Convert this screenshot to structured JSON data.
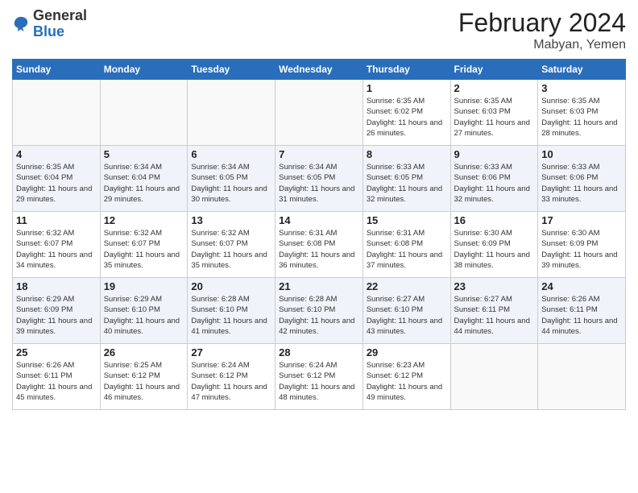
{
  "header": {
    "logo_general": "General",
    "logo_blue": "Blue",
    "month": "February 2024",
    "location": "Mabyan, Yemen"
  },
  "days_of_week": [
    "Sunday",
    "Monday",
    "Tuesday",
    "Wednesday",
    "Thursday",
    "Friday",
    "Saturday"
  ],
  "weeks": [
    [
      {
        "day": "",
        "info": ""
      },
      {
        "day": "",
        "info": ""
      },
      {
        "day": "",
        "info": ""
      },
      {
        "day": "",
        "info": ""
      },
      {
        "day": "1",
        "info": "Sunrise: 6:35 AM\nSunset: 6:02 PM\nDaylight: 11 hours and 26 minutes."
      },
      {
        "day": "2",
        "info": "Sunrise: 6:35 AM\nSunset: 6:03 PM\nDaylight: 11 hours and 27 minutes."
      },
      {
        "day": "3",
        "info": "Sunrise: 6:35 AM\nSunset: 6:03 PM\nDaylight: 11 hours and 28 minutes."
      }
    ],
    [
      {
        "day": "4",
        "info": "Sunrise: 6:35 AM\nSunset: 6:04 PM\nDaylight: 11 hours and 29 minutes."
      },
      {
        "day": "5",
        "info": "Sunrise: 6:34 AM\nSunset: 6:04 PM\nDaylight: 11 hours and 29 minutes."
      },
      {
        "day": "6",
        "info": "Sunrise: 6:34 AM\nSunset: 6:05 PM\nDaylight: 11 hours and 30 minutes."
      },
      {
        "day": "7",
        "info": "Sunrise: 6:34 AM\nSunset: 6:05 PM\nDaylight: 11 hours and 31 minutes."
      },
      {
        "day": "8",
        "info": "Sunrise: 6:33 AM\nSunset: 6:05 PM\nDaylight: 11 hours and 32 minutes."
      },
      {
        "day": "9",
        "info": "Sunrise: 6:33 AM\nSunset: 6:06 PM\nDaylight: 11 hours and 32 minutes."
      },
      {
        "day": "10",
        "info": "Sunrise: 6:33 AM\nSunset: 6:06 PM\nDaylight: 11 hours and 33 minutes."
      }
    ],
    [
      {
        "day": "11",
        "info": "Sunrise: 6:32 AM\nSunset: 6:07 PM\nDaylight: 11 hours and 34 minutes."
      },
      {
        "day": "12",
        "info": "Sunrise: 6:32 AM\nSunset: 6:07 PM\nDaylight: 11 hours and 35 minutes."
      },
      {
        "day": "13",
        "info": "Sunrise: 6:32 AM\nSunset: 6:07 PM\nDaylight: 11 hours and 35 minutes."
      },
      {
        "day": "14",
        "info": "Sunrise: 6:31 AM\nSunset: 6:08 PM\nDaylight: 11 hours and 36 minutes."
      },
      {
        "day": "15",
        "info": "Sunrise: 6:31 AM\nSunset: 6:08 PM\nDaylight: 11 hours and 37 minutes."
      },
      {
        "day": "16",
        "info": "Sunrise: 6:30 AM\nSunset: 6:09 PM\nDaylight: 11 hours and 38 minutes."
      },
      {
        "day": "17",
        "info": "Sunrise: 6:30 AM\nSunset: 6:09 PM\nDaylight: 11 hours and 39 minutes."
      }
    ],
    [
      {
        "day": "18",
        "info": "Sunrise: 6:29 AM\nSunset: 6:09 PM\nDaylight: 11 hours and 39 minutes."
      },
      {
        "day": "19",
        "info": "Sunrise: 6:29 AM\nSunset: 6:10 PM\nDaylight: 11 hours and 40 minutes."
      },
      {
        "day": "20",
        "info": "Sunrise: 6:28 AM\nSunset: 6:10 PM\nDaylight: 11 hours and 41 minutes."
      },
      {
        "day": "21",
        "info": "Sunrise: 6:28 AM\nSunset: 6:10 PM\nDaylight: 11 hours and 42 minutes."
      },
      {
        "day": "22",
        "info": "Sunrise: 6:27 AM\nSunset: 6:10 PM\nDaylight: 11 hours and 43 minutes."
      },
      {
        "day": "23",
        "info": "Sunrise: 6:27 AM\nSunset: 6:11 PM\nDaylight: 11 hours and 44 minutes."
      },
      {
        "day": "24",
        "info": "Sunrise: 6:26 AM\nSunset: 6:11 PM\nDaylight: 11 hours and 44 minutes."
      }
    ],
    [
      {
        "day": "25",
        "info": "Sunrise: 6:26 AM\nSunset: 6:11 PM\nDaylight: 11 hours and 45 minutes."
      },
      {
        "day": "26",
        "info": "Sunrise: 6:25 AM\nSunset: 6:12 PM\nDaylight: 11 hours and 46 minutes."
      },
      {
        "day": "27",
        "info": "Sunrise: 6:24 AM\nSunset: 6:12 PM\nDaylight: 11 hours and 47 minutes."
      },
      {
        "day": "28",
        "info": "Sunrise: 6:24 AM\nSunset: 6:12 PM\nDaylight: 11 hours and 48 minutes."
      },
      {
        "day": "29",
        "info": "Sunrise: 6:23 AM\nSunset: 6:12 PM\nDaylight: 11 hours and 49 minutes."
      },
      {
        "day": "",
        "info": ""
      },
      {
        "day": "",
        "info": ""
      }
    ]
  ]
}
